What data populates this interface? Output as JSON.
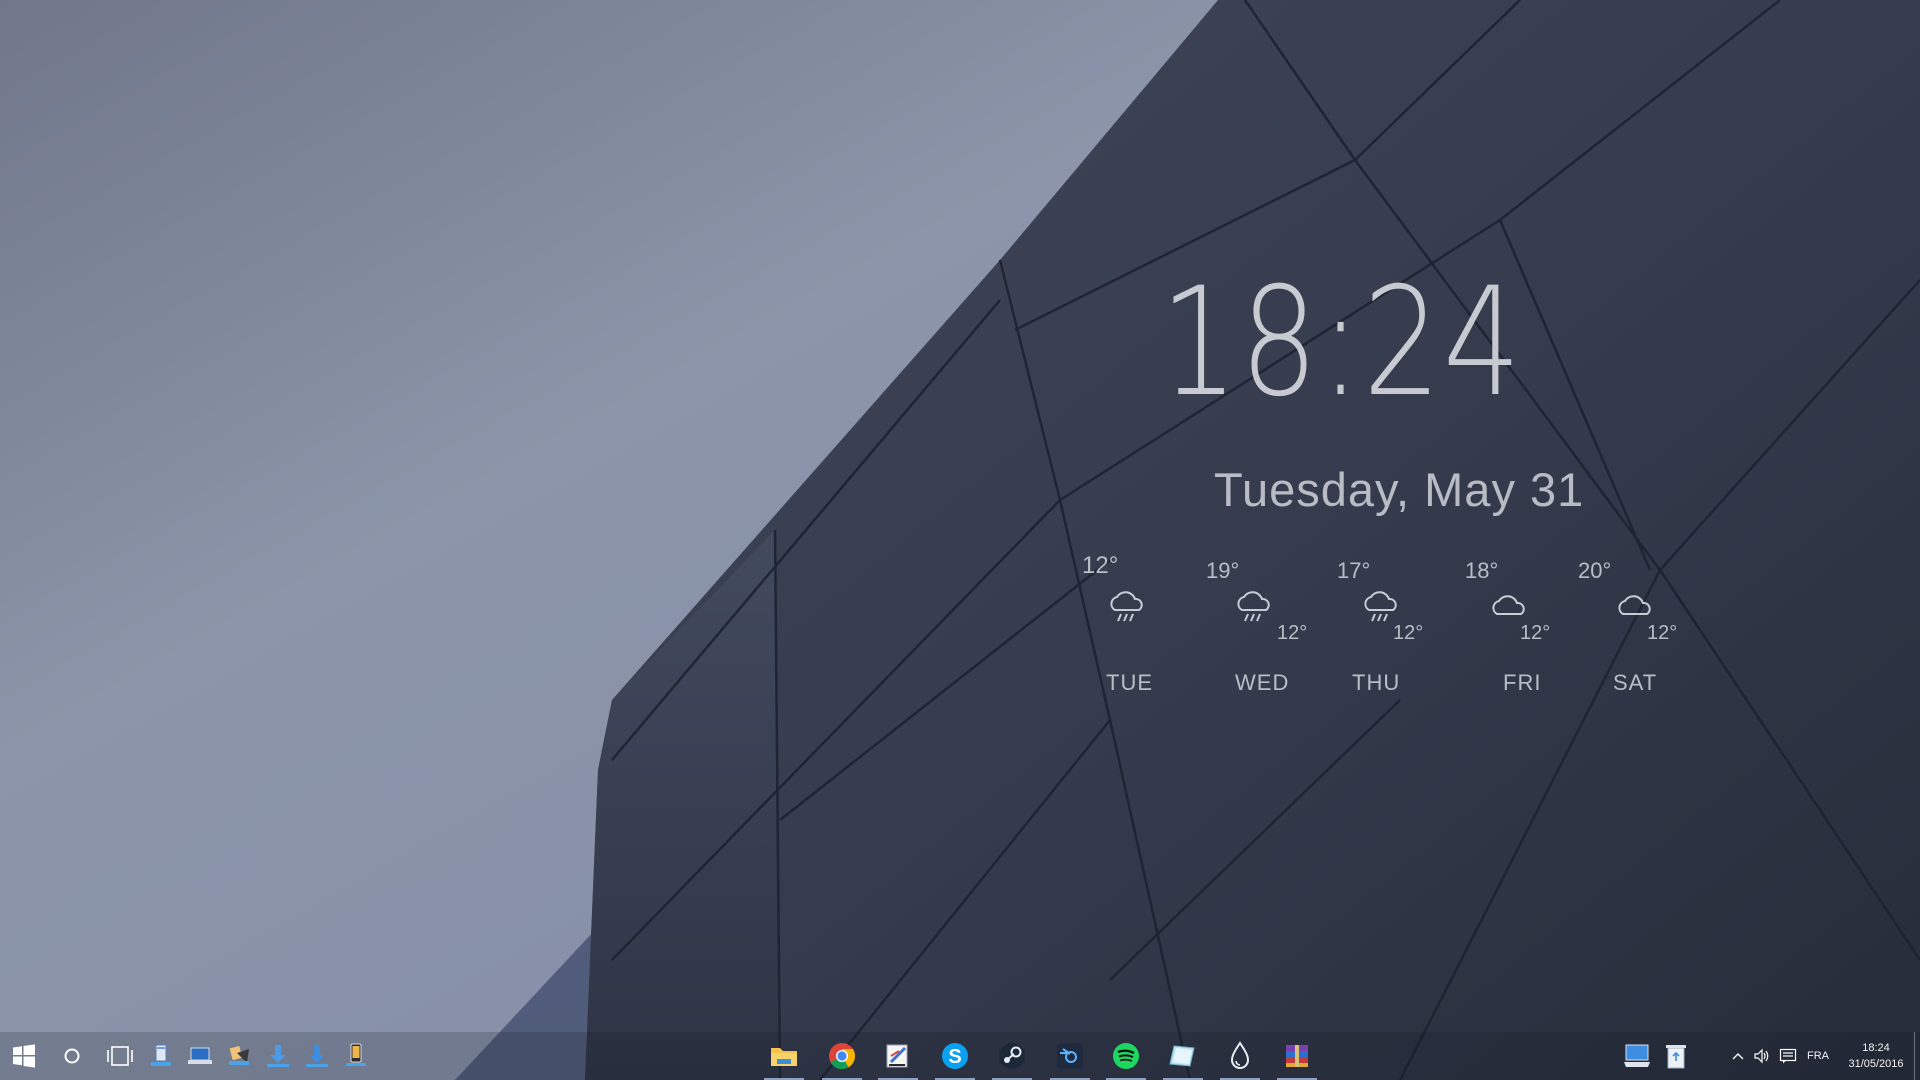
{
  "desktop": {
    "wallpaper": "grey sky and dark angular building facade"
  },
  "widget": {
    "time": "18:24",
    "date": "Tuesday, May 31",
    "forecast": [
      {
        "day": "TUE",
        "high": "12°",
        "low": "",
        "icon": "rain-cloud-icon"
      },
      {
        "day": "WED",
        "high": "19°",
        "low": "12°",
        "icon": "rain-cloud-icon"
      },
      {
        "day": "THU",
        "high": "17°",
        "low": "12°",
        "icon": "rain-cloud-icon"
      },
      {
        "day": "FRI",
        "high": "18°",
        "low": "12°",
        "icon": "cloud-icon"
      },
      {
        "day": "SAT",
        "high": "20°",
        "low": "12°",
        "icon": "cloud-icon"
      }
    ]
  },
  "taskbar": {
    "left": [
      "start-icon",
      "cortana-icon",
      "task-view-icon",
      "this-pc-icon",
      "network-icon",
      "control-panel-icon",
      "downloads-icon",
      "download-arrow-icon",
      "phone-icon"
    ],
    "apps": [
      "file-explorer-icon",
      "chrome-icon",
      "paint-icon",
      "skype-icon",
      "steam-icon",
      "blender-icon",
      "spotify-icon",
      "notes-icon",
      "raindrop-icon",
      "winrar-icon"
    ],
    "desktop_icons": [
      "computer-icon",
      "recycle-bin-icon"
    ],
    "tray": {
      "language": "FRA",
      "time": "18:24",
      "date": "31/05/2016"
    }
  }
}
